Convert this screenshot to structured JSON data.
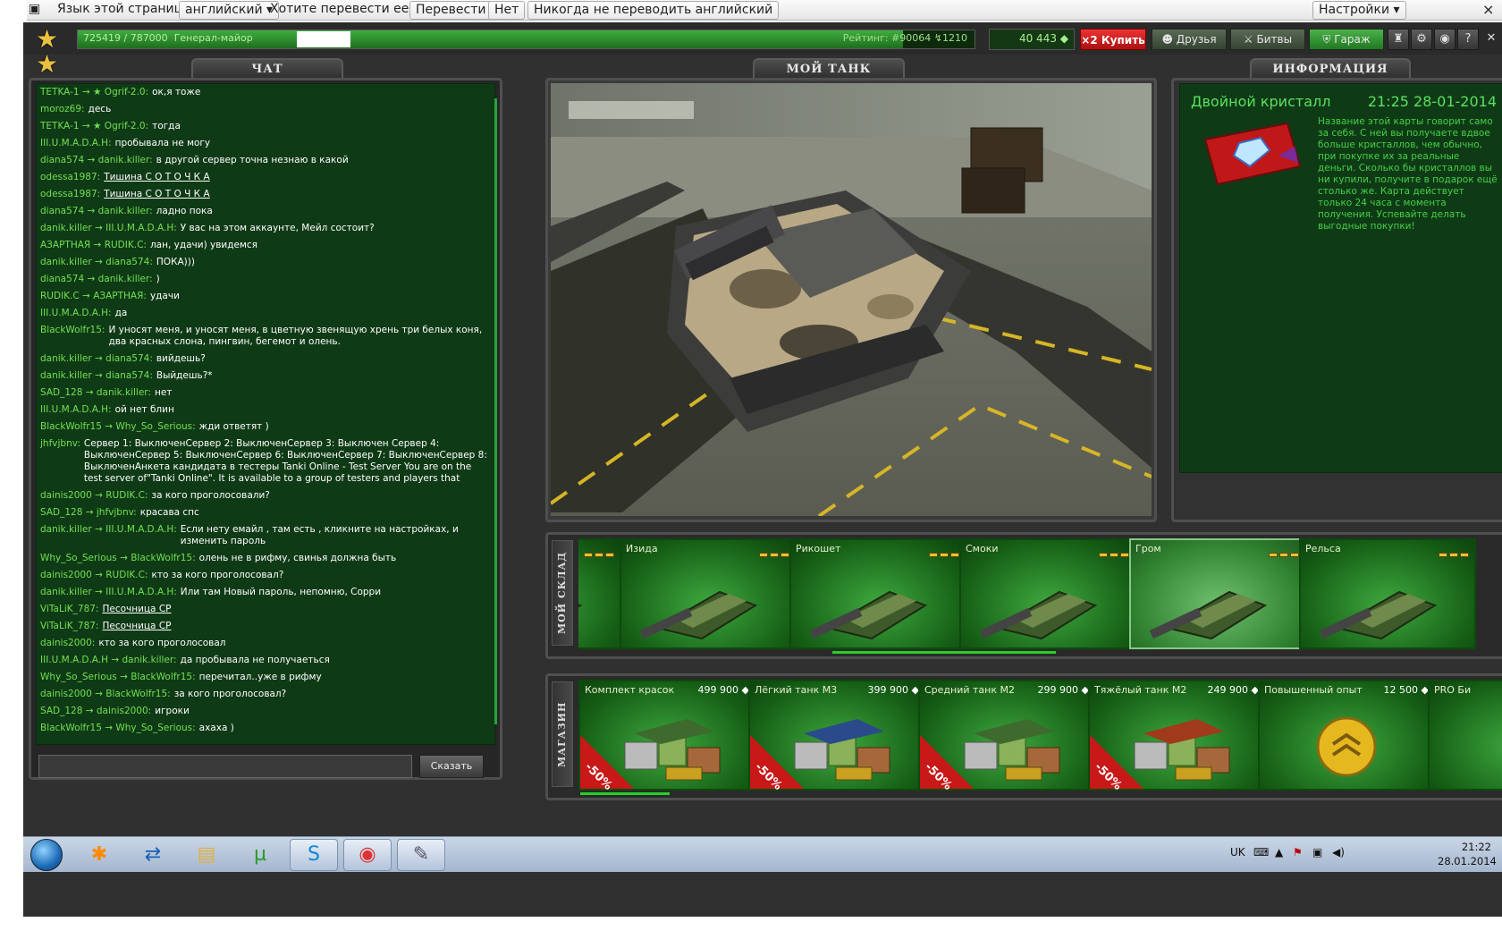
{
  "translate_bar": {
    "prefix": "Язык этой страницы",
    "language": "английский ▾",
    "question": "Хотите перевести ее?",
    "translate_btn": "Перевести",
    "no_btn": "Нет",
    "never_btn": "Никогда не переводить английский",
    "settings_btn": "Настройки ▾"
  },
  "topbar": {
    "xp": "725419 / 787000",
    "rank": "Генерал-майор",
    "xp_progress": 0.92,
    "rating": "Рейтинг: #90064",
    "rating_delta": "↯1210",
    "crystals": "40 443 ◆",
    "buy": "Купить",
    "buy_prefix": "×2",
    "friends": "Друзья",
    "battles": "Битвы",
    "garage": "Гараж"
  },
  "tabs": {
    "chat": "ЧАТ",
    "my_tank": "МОЙ ТАНК",
    "info": "ИНФОРМАЦИЯ"
  },
  "chat": {
    "messages": [
      {
        "from": "TETKA-1 → ★ Ogrif-2.0:",
        "text": "ок,я тоже"
      },
      {
        "from": "moroz69:",
        "text": "десь"
      },
      {
        "from": "TETKA-1 → ★ Ogrif-2.0:",
        "text": "тогда"
      },
      {
        "from": "III.U.M.A.D.A.H:",
        "text": "пробывала не могу"
      },
      {
        "from": "diana574 → danik.killer:",
        "text": "в другой сервер точна незнаю в какой"
      },
      {
        "from": "odessa1987:",
        "text": "Тишина С О Т О Ч К А",
        "link": true
      },
      {
        "from": "odessa1987:",
        "text": "Тишина С О Т О Ч К А",
        "link": true
      },
      {
        "from": "diana574 → danik.killer:",
        "text": "ладно пока"
      },
      {
        "from": "danik.killer → III.U.M.A.D.A.H:",
        "text": "У вас на этом аккаунте, Мейл состоит?"
      },
      {
        "from": "АЗАРТНАЯ → RUDIK.C:",
        "text": "лан, удачи) увидемся"
      },
      {
        "from": "danik.killer → diana574:",
        "text": "ПОКА)))"
      },
      {
        "from": "diana574 → danik.killer:",
        "text": ")"
      },
      {
        "from": "RUDIK.C → АЗАРТНАЯ:",
        "text": "удачи"
      },
      {
        "from": "III.U.M.A.D.A.H:",
        "text": "да"
      },
      {
        "from": "BlackWolfr15:",
        "text": "И уносят меня, и уносят меня, в цветную звенящую хрень три белых коня, два красных слона, пингвин, бегемот и олень."
      },
      {
        "from": "danik.killer → diana574:",
        "text": "вийдешь?"
      },
      {
        "from": "danik.killer → diana574:",
        "text": "Выйдешь?*"
      },
      {
        "from": "SAD_128 → danik.killer:",
        "text": "нет"
      },
      {
        "from": "III.U.M.A.D.A.H:",
        "text": "ой нет блин"
      },
      {
        "from": "BlackWolfr15 → Why_So_Serious:",
        "text": "жди ответят )"
      },
      {
        "from": "jhfvjbnv:",
        "text": "Сервер 1: ВыключенСервер 2: ВыключенСервер 3: Выключен Сервер 4: ВыключенСервер 5: ВыключенСервер 6: ВыключенСервер 7: ВыключенСервер 8: ВыключенАнкета кандидата в тестеры Tanki Online - Test Server You are on the test server of\"Tanki Online\". It is available to a group of testers and players that"
      },
      {
        "from": "dainis2000 → RUDIK.C:",
        "text": "за кого проголосовали?"
      },
      {
        "from": "SAD_128 → jhfvjbnv:",
        "text": "красава спс"
      },
      {
        "from": "danik.killer → III.U.M.A.D.A.H:",
        "text": "Если нету емайл , там есть , кликните на настройках, и изменить пароль"
      },
      {
        "from": "Why_So_Serious → BlackWolfr15:",
        "text": "олень не в рифму, свинья должна быть"
      },
      {
        "from": "dainis2000 → RUDIK.C:",
        "text": "кто за кого проголосовал?"
      },
      {
        "from": "danik.killer → III.U.M.A.D.A.H:",
        "text": "Или там Новый пароль, непомню, Сорри"
      },
      {
        "from": "ViTaLiK_787:",
        "text": "Песочница СР",
        "link": true
      },
      {
        "from": "ViTaLiK_787:",
        "text": "Песочница СР",
        "link": true
      },
      {
        "from": "dainis2000:",
        "text": "кто за кого проголосовал"
      },
      {
        "from": "III.U.M.A.D.A.H → danik.killer:",
        "text": "да пробывала не получаеться"
      },
      {
        "from": "Why_So_Serious → BlackWolfr15:",
        "text": "перечитал..уже в рифму"
      },
      {
        "from": "dainis2000 → BlackWolfr15:",
        "text": "за кого проголосовал?"
      },
      {
        "from": "SAD_128 → dainis2000:",
        "text": "игроки"
      },
      {
        "from": "BlackWolfr15 → Why_So_Serious:",
        "text": "ахаха )"
      }
    ],
    "send_label": "Сказать"
  },
  "info": {
    "title": "Двойной кристалл",
    "time": "21:25  28-01-2014",
    "text": "Название этой карты говорит само за себя. С ней вы получаете вдвое больше кристаллов, чем обычно, при покупке их за реальные деньги. Сколько бы кристаллов вы ни купили, получите в подарок ещё столько же. Карта действует только 24 часа с момента получения. Успевайте делать выгодные покупки!"
  },
  "warehouse": {
    "label": "МОЙ СКЛАД",
    "items": [
      {
        "name": ""
      },
      {
        "name": "Изида"
      },
      {
        "name": "Рикошет"
      },
      {
        "name": "Смоки"
      },
      {
        "name": "Гром",
        "selected": true
      },
      {
        "name": "Рельса"
      }
    ]
  },
  "shop": {
    "label": "МАГАЗИН",
    "items": [
      {
        "name": "Комплект красок",
        "price": "499 900 ◆",
        "sale": "-50%"
      },
      {
        "name": "Лёгкий танк М3",
        "price": "399 900 ◆",
        "sale": "-50%"
      },
      {
        "name": "Средний танк М2",
        "price": "299 900 ◆",
        "sale": "-50%"
      },
      {
        "name": "Тяжёлый танк М2",
        "price": "249 900 ◆",
        "sale": "-50%"
      },
      {
        "name": "Повышенный опыт",
        "price": "12 500 ◆",
        "sale": ""
      },
      {
        "name": "PRO Би",
        "price": "",
        "sale": ""
      }
    ]
  },
  "taskbar": {
    "lang": "UK",
    "time": "21:22",
    "date": "28.01.2014"
  },
  "colors": {
    "chat_bg": "#0f3a16",
    "accent_green": "#27d027",
    "sale_red": "#c81818"
  }
}
